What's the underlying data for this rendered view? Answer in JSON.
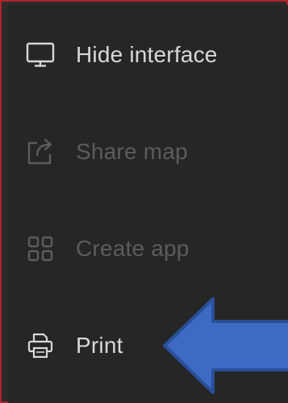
{
  "menu": {
    "items": [
      {
        "label": "Hide interface",
        "icon": "monitor-icon",
        "enabled": true
      },
      {
        "label": "Share map",
        "icon": "share-icon",
        "enabled": false
      },
      {
        "label": "Create app",
        "icon": "apps-grid-icon",
        "enabled": false
      },
      {
        "label": "Print",
        "icon": "printer-icon",
        "enabled": true
      }
    ]
  },
  "colors": {
    "panel_background": "#262626",
    "enabled_text": "#d8d8d8",
    "disabled_text": "#5c5c5c",
    "frame_border": "#b0232a",
    "callout_arrow_fill": "#3d6bc4",
    "callout_arrow_stroke": "#2a4f99"
  }
}
